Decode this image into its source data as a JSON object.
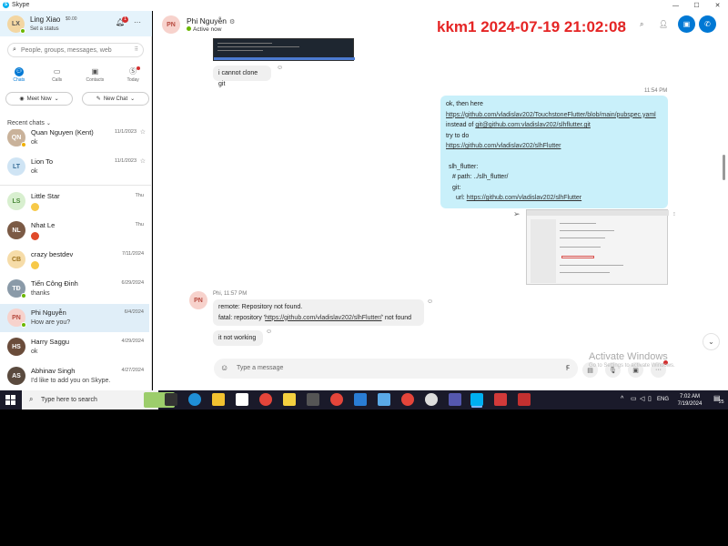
{
  "window": {
    "app_title": "Skype"
  },
  "watermark": "kkm1 2024-07-19 21:02:08",
  "profile": {
    "initials": "LX",
    "name": "Ling Xiao",
    "credit": "$0.00",
    "status": "Set a status",
    "notification_count": "1"
  },
  "search": {
    "placeholder": "People, groups, messages, web"
  },
  "nav_tabs": [
    {
      "label": "Chats",
      "icon": "chat-icon"
    },
    {
      "label": "Calls",
      "icon": "calls-icon"
    },
    {
      "label": "Contacts",
      "icon": "contacts-icon"
    },
    {
      "label": "Today",
      "icon": "today-icon"
    }
  ],
  "actions": {
    "meet_now": "Meet Now",
    "new_chat": "New Chat"
  },
  "recent_chats_label": "Recent chats",
  "chats": [
    {
      "initials": "QN",
      "name": "Quan Nguyen (Kent)",
      "preview": "ok",
      "date": "11/1/2023"
    },
    {
      "initials": "LT",
      "name": "Lion To",
      "preview": "ok",
      "date": "11/1/2023"
    },
    {
      "initials": "LS",
      "name": "Little Star",
      "preview": "",
      "date": "Thu"
    },
    {
      "initials": "NL",
      "name": "Nhat Le",
      "preview": "",
      "date": "Thu"
    },
    {
      "initials": "CB",
      "name": "crazy bestdev",
      "preview": "",
      "date": "7/11/2024"
    },
    {
      "initials": "TĐ",
      "name": "Tiến Công Đinh",
      "preview": "thanks",
      "date": "6/29/2024"
    },
    {
      "initials": "PN",
      "name": "Phi Nguyễn",
      "preview": "How are you?",
      "date": "6/4/2024"
    },
    {
      "initials": "HS",
      "name": "Harry Saggu",
      "preview": "ok",
      "date": "4/29/2024"
    },
    {
      "initials": "AS",
      "name": "Abhinav Singh",
      "preview": "I'd like to add you on Skype.",
      "date": "4/27/2024"
    }
  ],
  "conversation": {
    "initials": "PN",
    "name": "Phi Nguyễn",
    "status": "Active now",
    "messages": {
      "m1": "i cannot clone git",
      "time_out": "11:54 PM",
      "out_lines": {
        "l1": "ok, then here",
        "l2": "https://github.com/vladislav202/TouchstoneFlutter/blob/main/pubspec.yaml",
        "l3a": "instead of ",
        "l3b": "git@github.com:vladislav202/slhflutter.git",
        "l4": "try to do",
        "l5": "https://github.com/vladislav202/slhFlutter",
        "l6": "slh_flutter:",
        "l7": "# path: ../slh_flutter/",
        "l8": "git:",
        "l9a": "url: ",
        "l9b": "https://github.com/vladislav202/slhFlutter"
      },
      "in_meta": "Phi, 11:57 PM",
      "in_lines": {
        "l1": "remote: Repository not found.",
        "l2a": "fatal: repository '",
        "l2b": "https://github.com/vladislav202/slhFlutter/",
        "l2c": "' not found"
      },
      "m3": "it not working"
    },
    "composer_placeholder": "Type a message"
  },
  "activate_windows": {
    "title": "Activate Windows",
    "subtitle": "Go to Settings to activate Windows."
  },
  "taskbar": {
    "search_placeholder": "Type here to search",
    "language": "ENG",
    "time": "7:02 AM",
    "date": "7/19/2024",
    "notification_count": "25"
  },
  "colors": {
    "accent": "#0078d4",
    "outgoing_bubble": "#c9f0fa",
    "watermark": "#e52525"
  }
}
